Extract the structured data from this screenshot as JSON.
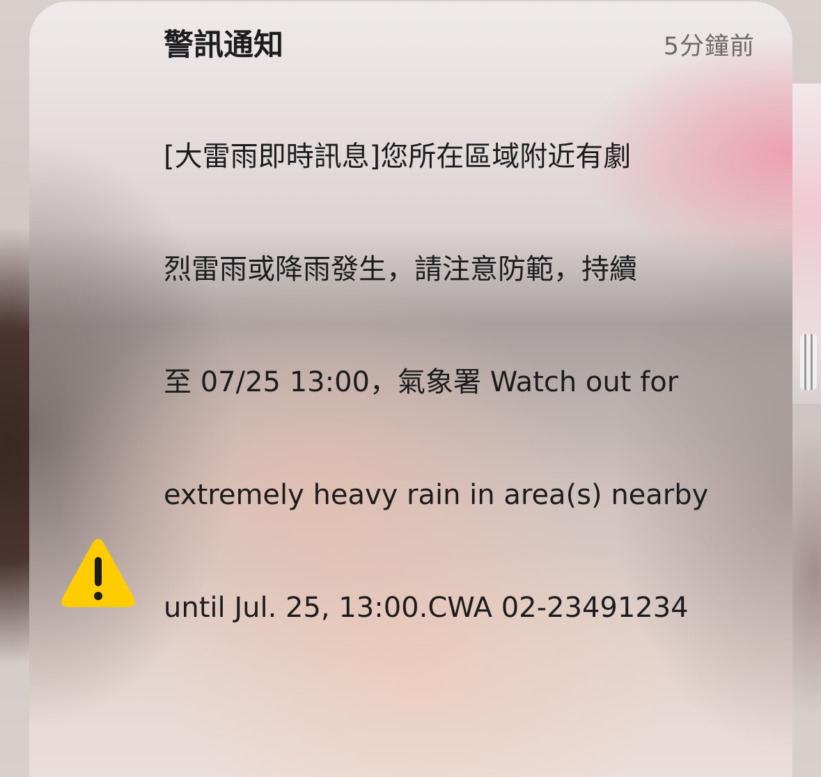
{
  "notification": {
    "app_title": "警訊通知",
    "timestamp": "5分鐘前",
    "message_lines": [
      "[大雷雨即時訊息]您所在區域附近有劇",
      "烈雷雨或降雨發生，請注意防範，持續",
      "至 07/25 13:00，氣象署 Watch out for",
      "extremely heavy rain in area(s) nearby",
      "until Jul. 25, 13:00.CWA 02-23491234"
    ],
    "icon": "warning-triangle-icon",
    "icon_color": "#FFCC00"
  }
}
